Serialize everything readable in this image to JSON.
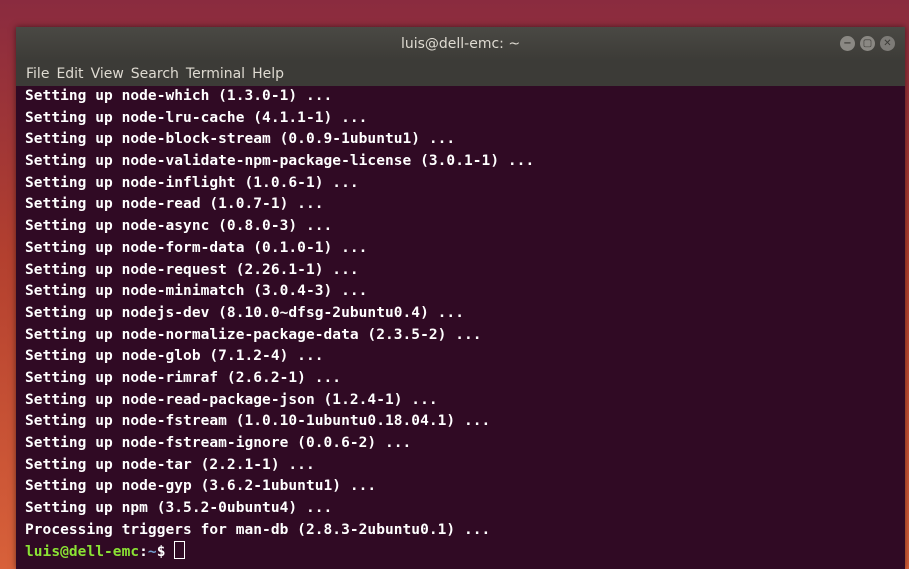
{
  "window": {
    "title": "luis@dell-emc: ~"
  },
  "menu": [
    "File",
    "Edit",
    "View",
    "Search",
    "Terminal",
    "Help"
  ],
  "controls": {
    "minimize_glyph": "−",
    "maximize_glyph": "▢",
    "close_glyph": "✕"
  },
  "terminal": {
    "lines": [
      "Setting up node-which (1.3.0-1) ...",
      "Setting up node-lru-cache (4.1.1-1) ...",
      "Setting up node-block-stream (0.0.9-1ubuntu1) ...",
      "Setting up node-validate-npm-package-license (3.0.1-1) ...",
      "Setting up node-inflight (1.0.6-1) ...",
      "Setting up node-read (1.0.7-1) ...",
      "Setting up node-async (0.8.0-3) ...",
      "Setting up node-form-data (0.1.0-1) ...",
      "Setting up node-request (2.26.1-1) ...",
      "Setting up node-minimatch (3.0.4-3) ...",
      "Setting up nodejs-dev (8.10.0~dfsg-2ubuntu0.4) ...",
      "Setting up node-normalize-package-data (2.3.5-2) ...",
      "Setting up node-glob (7.1.2-4) ...",
      "Setting up node-rimraf (2.6.2-1) ...",
      "Setting up node-read-package-json (1.2.4-1) ...",
      "Setting up node-fstream (1.0.10-1ubuntu0.18.04.1) ...",
      "Setting up node-fstream-ignore (0.0.6-2) ...",
      "Setting up node-tar (2.2.1-1) ...",
      "Setting up node-gyp (3.6.2-1ubuntu1) ...",
      "Setting up npm (3.5.2-0ubuntu4) ...",
      "Processing triggers for man-db (2.8.3-2ubuntu0.1) ..."
    ],
    "prompt": {
      "user_host": "luis@dell-emc",
      "sep": ":",
      "path": "~",
      "symbol": "$ "
    }
  },
  "colors": {
    "terminal_bg": "#300a24",
    "prompt_user": "#8ae234",
    "prompt_path": "#729fcf"
  }
}
